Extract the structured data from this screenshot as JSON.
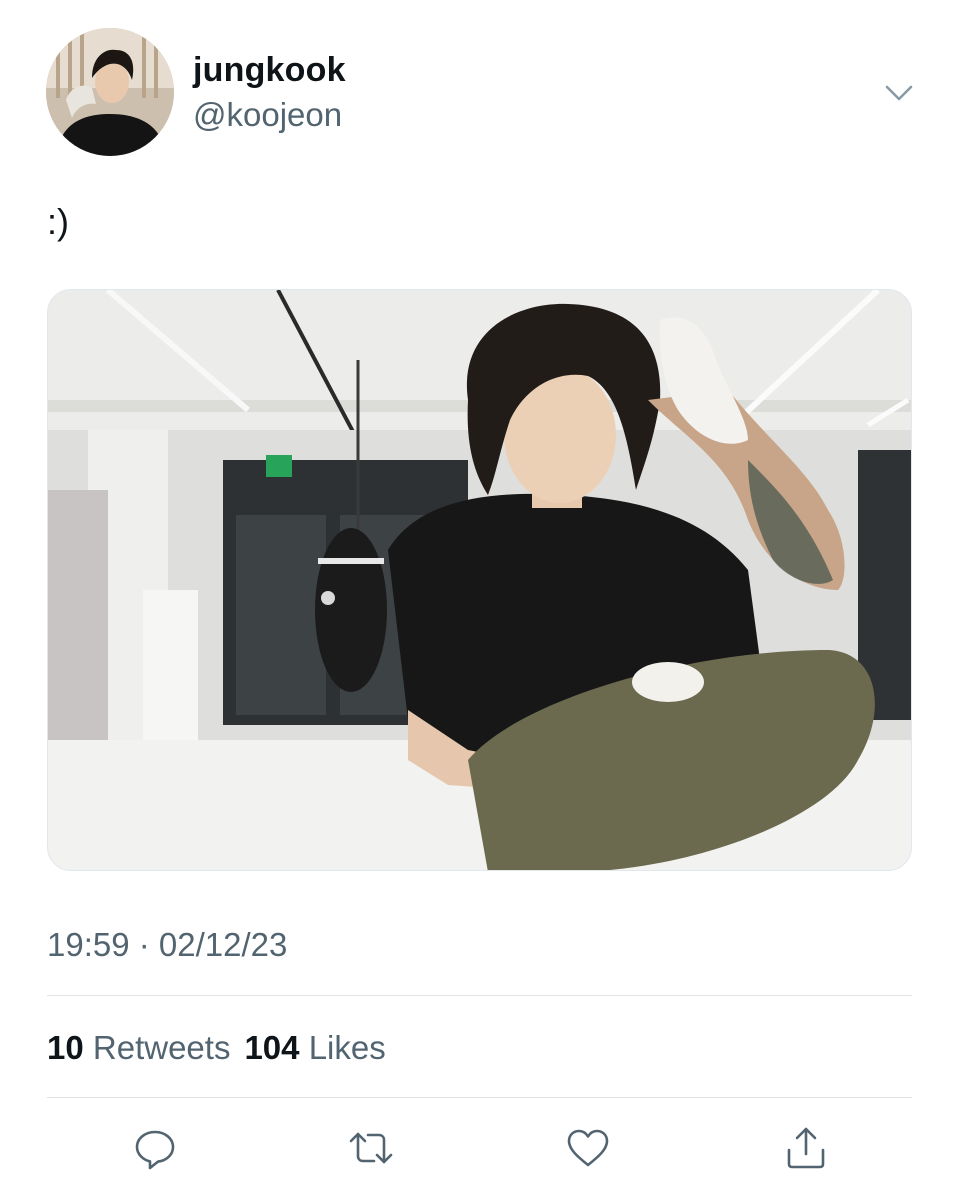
{
  "tweet": {
    "display_name": "jungkook",
    "handle": "@koojeon",
    "text": ":)",
    "timestamp": "19:59 · 02/12/23",
    "media_alt": "photo"
  },
  "stats": {
    "retweets_count": "10",
    "retweets_label": "Retweets",
    "likes_count": "104",
    "likes_label": "Likes"
  },
  "icons": {
    "menu": "chevron-down-icon",
    "reply": "reply-icon",
    "retweet": "retweet-icon",
    "like": "heart-icon",
    "share": "share-icon"
  },
  "colors": {
    "text_primary": "#0f1419",
    "text_secondary": "#536471",
    "icon": "#536471",
    "divider": "#dfe3e6"
  }
}
